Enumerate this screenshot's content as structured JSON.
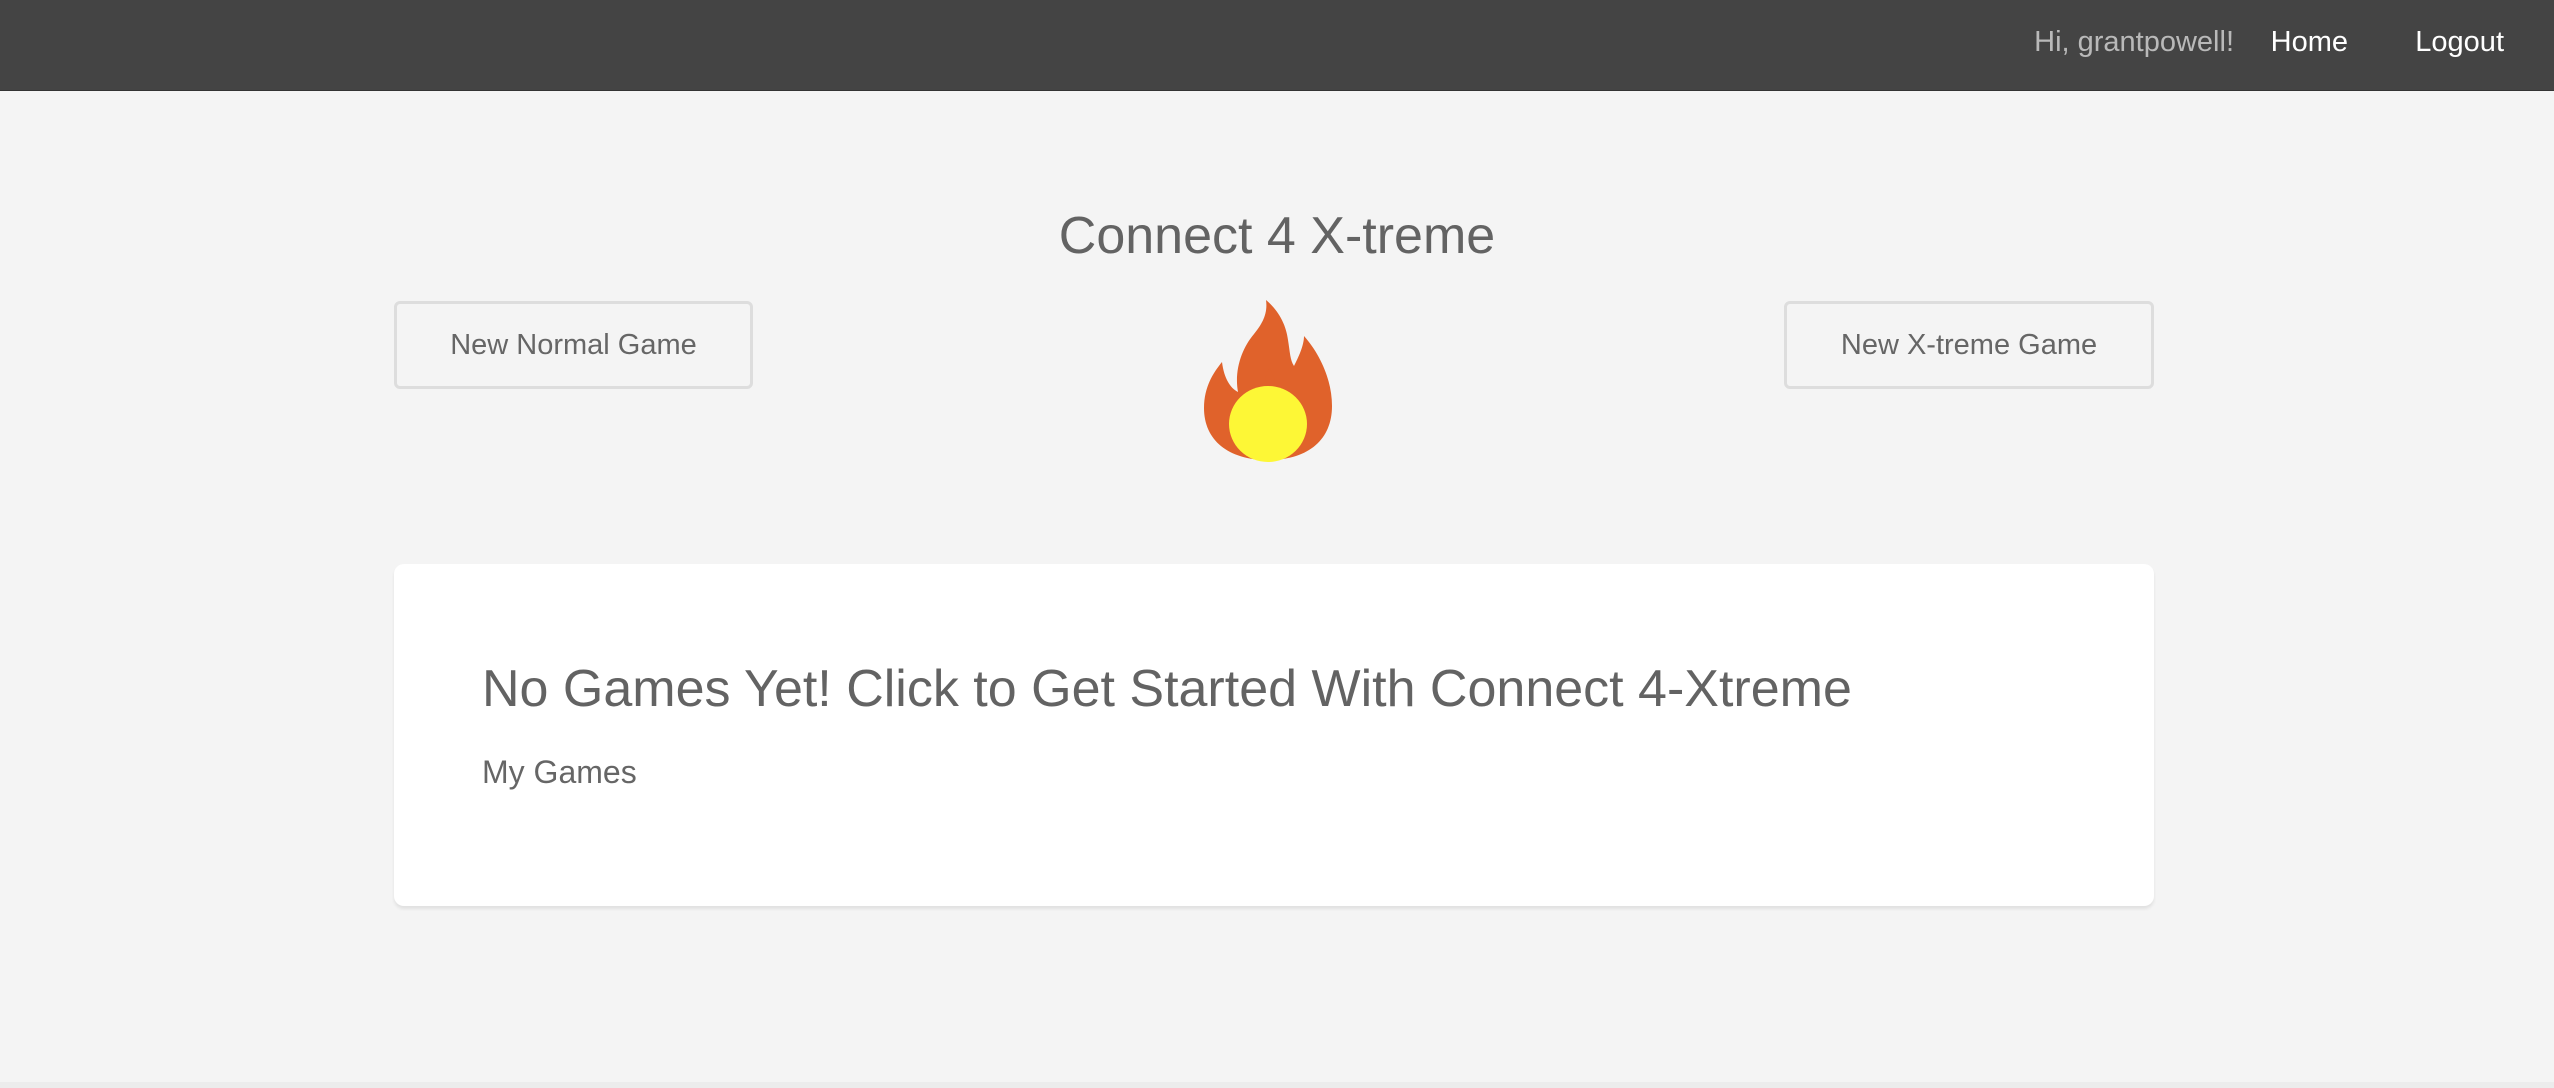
{
  "navbar": {
    "greeting": "Hi, grantpowell!",
    "home_label": "Home",
    "logout_label": "Logout"
  },
  "header": {
    "title": "Connect 4 X-treme"
  },
  "actions": {
    "new_normal_label": "New Normal Game",
    "new_xtreme_label": "New X-treme Game"
  },
  "logo": {
    "icon": "flame-icon",
    "flame_color": "#e0622b",
    "ball_color": "#fdf736"
  },
  "games_card": {
    "heading": "No Games Yet! Click to Get Started With Connect 4-Xtreme",
    "subheading": "My Games"
  },
  "colors": {
    "navbar_bg": "#444444",
    "page_bg": "#f4f4f4",
    "card_bg": "#ffffff",
    "text": "#636363"
  }
}
